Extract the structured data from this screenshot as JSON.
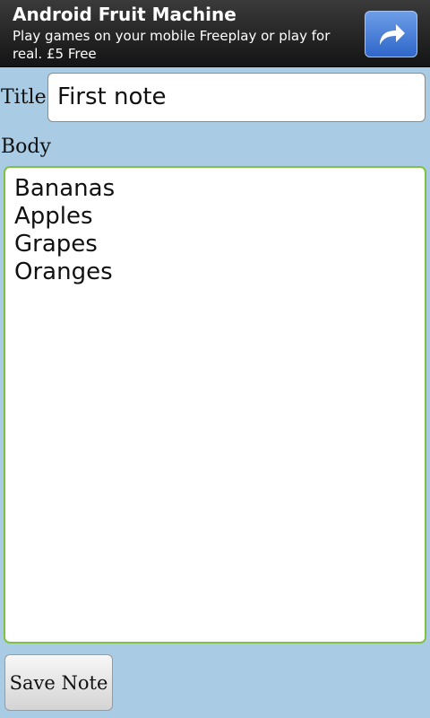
{
  "ad": {
    "title": "Android Fruit Machine",
    "text": "Play games on your mobile Freeplay or play for real. £5 Free",
    "action_icon": "share-arrow-icon"
  },
  "form": {
    "title_label": "Title",
    "title_value": "First note",
    "body_label": "Body",
    "body_lines": [
      "Bananas",
      "Apples",
      "Grapes",
      "Oranges"
    ],
    "save_label": "Save Note"
  },
  "colors": {
    "background": "#a9cbe4",
    "focus_border": "#7fc242",
    "ad_button": "#3f75d6"
  }
}
